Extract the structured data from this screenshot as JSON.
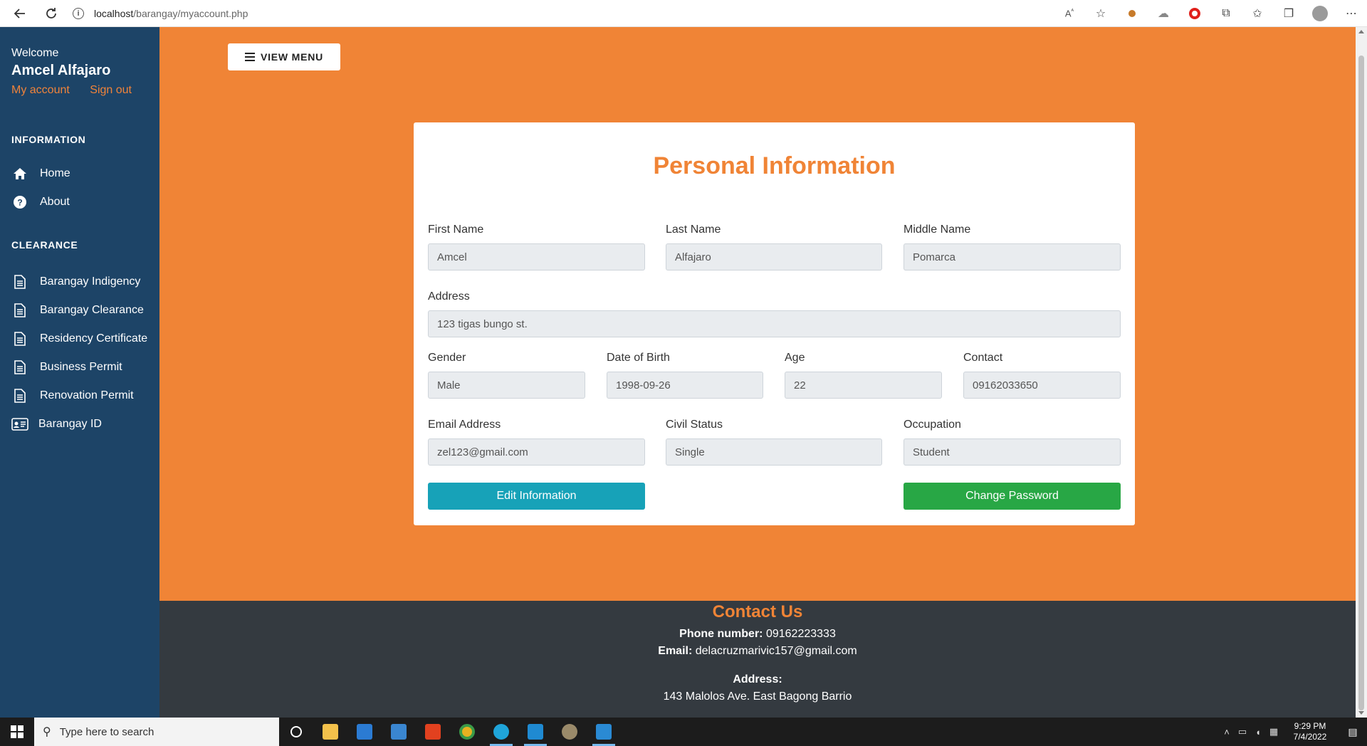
{
  "browser": {
    "url_host": "localhost",
    "url_path": "/barangay/myaccount.php",
    "icons": [
      "back-icon",
      "reload-icon",
      "info-icon",
      "read-aloud-icon",
      "favorite-add-icon",
      "extension-icon",
      "opera-icon",
      "puzzle-icon",
      "favorites-icon",
      "collections-icon",
      "profile-icon",
      "more-icon"
    ]
  },
  "sidebar": {
    "welcome": "Welcome",
    "user_name": "Amcel Alfajaro",
    "my_account": "My account",
    "sign_out": "Sign out",
    "information_heading": "INFORMATION",
    "information_items": [
      {
        "label": "Home",
        "icon": "home-icon"
      },
      {
        "label": "About",
        "icon": "question-icon"
      }
    ],
    "clearance_heading": "CLEARANCE",
    "clearance_items": [
      {
        "label": "Barangay Indigency",
        "icon": "document-icon"
      },
      {
        "label": "Barangay Clearance",
        "icon": "document-icon"
      },
      {
        "label": "Residency Certificate",
        "icon": "document-icon"
      },
      {
        "label": "Business Permit",
        "icon": "document-icon"
      },
      {
        "label": "Renovation Permit",
        "icon": "document-icon"
      },
      {
        "label": "Barangay ID",
        "icon": "id-card-icon"
      }
    ]
  },
  "main": {
    "view_menu": "VIEW MENU",
    "title": "Personal Information",
    "fields": {
      "first_name": {
        "label": "First Name",
        "value": "Amcel"
      },
      "last_name": {
        "label": "Last Name",
        "value": "Alfajaro"
      },
      "middle_name": {
        "label": "Middle Name",
        "value": "Pomarca"
      },
      "address": {
        "label": "Address",
        "value": "123 tigas bungo st."
      },
      "gender": {
        "label": "Gender",
        "value": "Male"
      },
      "dob": {
        "label": "Date of Birth",
        "value": "1998-09-26"
      },
      "age": {
        "label": "Age",
        "value": "22"
      },
      "contact": {
        "label": "Contact",
        "value": "09162033650"
      },
      "email": {
        "label": "Email Address",
        "value": "zel123@gmail.com"
      },
      "civil_status": {
        "label": "Civil Status",
        "value": "Single"
      },
      "occupation": {
        "label": "Occupation",
        "value": "Student"
      }
    },
    "edit_button": "Edit Information",
    "change_password_button": "Change Password"
  },
  "footer": {
    "title": "Contact Us",
    "phone_label": "Phone number:",
    "phone_value": "09162223333",
    "email_label": "Email:",
    "email_value": "delacruzmarivic157@gmail.com",
    "address_label": "Address:",
    "address_value": "143 Malolos Ave. East Bagong Barrio"
  },
  "taskbar": {
    "search_placeholder": "Type here to search",
    "time": "9:29 PM",
    "date": "7/4/2022"
  },
  "colors": {
    "accent": "#f08436",
    "sidebar": "#1d4467",
    "footer": "#343a40",
    "info": "#17a2b8",
    "success": "#28a745"
  }
}
